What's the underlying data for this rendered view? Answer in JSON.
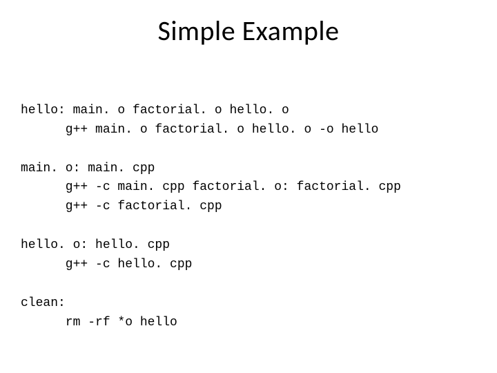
{
  "title": "Simple Example",
  "code": {
    "l1": "hello: main. o factorial. o hello. o",
    "l2": "      g++ main. o factorial. o hello. o -o hello",
    "l3": "",
    "l4": "main. o: main. cpp",
    "l5": "      g++ -c main. cpp factorial. o: factorial. cpp",
    "l6": "      g++ -c factorial. cpp",
    "l7": "",
    "l8": "hello. o: hello. cpp",
    "l9": "      g++ -c hello. cpp",
    "l10": "",
    "l11": "clean:",
    "l12": "      rm -rf *o hello"
  }
}
